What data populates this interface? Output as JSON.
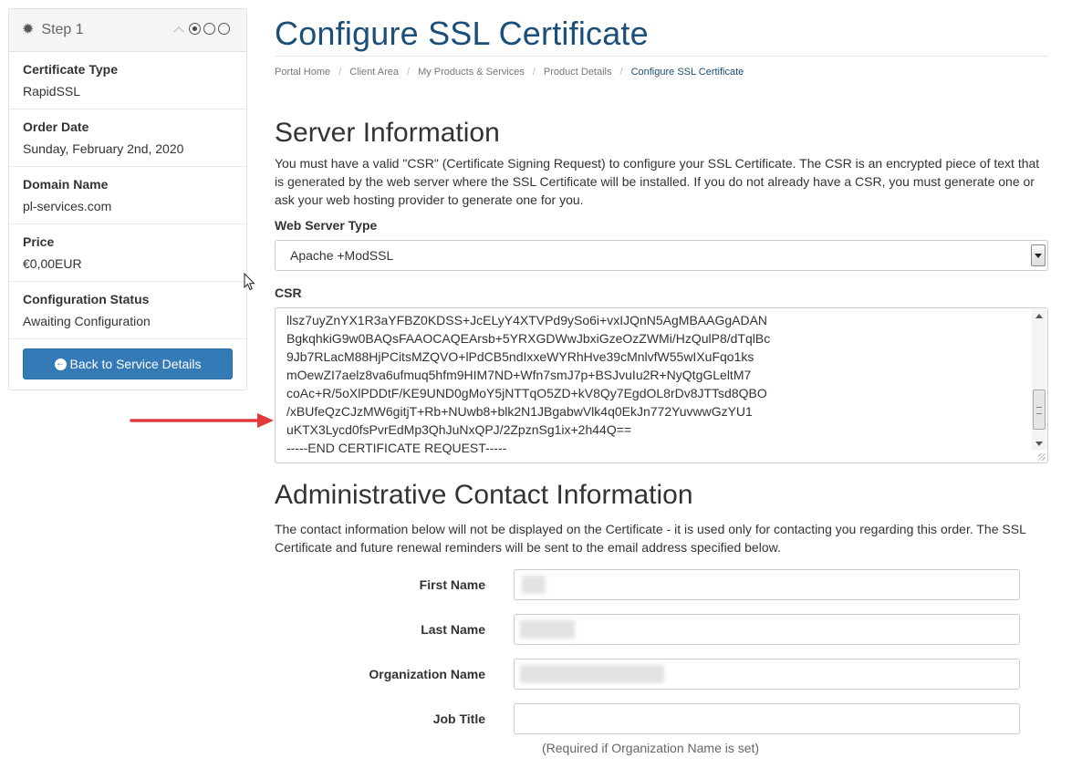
{
  "sidebar": {
    "step_title": "Step 1",
    "items": [
      {
        "label": "Certificate Type",
        "value": "RapidSSL"
      },
      {
        "label": "Order Date",
        "value": "Sunday, February 2nd, 2020"
      },
      {
        "label": "Domain Name",
        "value": "pl-services.com"
      },
      {
        "label": "Price",
        "value": "€0,00EUR"
      },
      {
        "label": "Configuration Status",
        "value": "Awaiting Configuration"
      }
    ],
    "back_button_label": "Back to Service Details",
    "step_indicator": {
      "total": 3,
      "current": 1
    }
  },
  "page": {
    "title": "Configure SSL Certificate",
    "breadcrumb": [
      "Portal Home",
      "Client Area",
      "My Products & Services",
      "Product Details",
      "Configure SSL Certificate"
    ]
  },
  "server_info": {
    "heading": "Server Information",
    "description": "You must have a valid \"CSR\" (Certificate Signing Request) to configure your SSL Certificate. The CSR is an encrypted piece of text that is generated by the web server where the SSL Certificate will be installed. If you do not already have a CSR, you must generate one or ask your web hosting provider to generate one for you.",
    "web_server_label": "Web Server Type",
    "web_server_value": "Apache +ModSSL",
    "csr_label": "CSR",
    "csr_value": "llsz7uyZnYX1R3aYFBZ0KDSS+JcELyY4XTVPd9ySo6i+vxIJQnN5AgMBAAGgADAN\nBgkqhkiG9w0BAQsFAAOCAQEArsb+5YRXGDWwJbxiGzeOzZWMi/HzQulP8/dTqlBc\n9Jb7RLacM88HjPCitsMZQVO+lPdCB5ndIxxeWYRhHve39cMnlvfW55wIXuFqo1ks\nmOewZI7aelz8va6ufmuq5hfm9HIM7ND+Wfn7smJ7p+BSJvuIu2R+NyQtgGLeltM7\ncoAc+R/5oXlPDDtF/KE9UND0gMoY5jNTTqO5ZD+kV8Qy7EgdOL8rDv8JTTsd8QBO\n/xBUfeQzCJzMW6gitjT+Rb+NUwb8+blk2N1JBgabwVlk4q0EkJn772YuvwwGzYU1\nuKTX3Lycd0fsPvrEdMp3QhJuNxQPJ/2ZpznSg1ix+2h44Q==\n-----END CERTIFICATE REQUEST-----"
  },
  "admin_contact": {
    "heading": "Administrative Contact Information",
    "description": "The contact information below will not be displayed on the Certificate - it is used only for contacting you regarding this order. The SSL Certificate and future renewal reminders will be sent to the email address specified below.",
    "fields": [
      {
        "label": "First Name",
        "value": ""
      },
      {
        "label": "Last Name",
        "value": ""
      },
      {
        "label": "Organization Name",
        "value": ""
      },
      {
        "label": "Job Title",
        "value": ""
      }
    ],
    "job_title_hint": "(Required if Organization Name is set)"
  },
  "colors": {
    "accent": "#337ab7",
    "title": "#1b4f7a",
    "annotation_arrow": "#e03a3a"
  }
}
